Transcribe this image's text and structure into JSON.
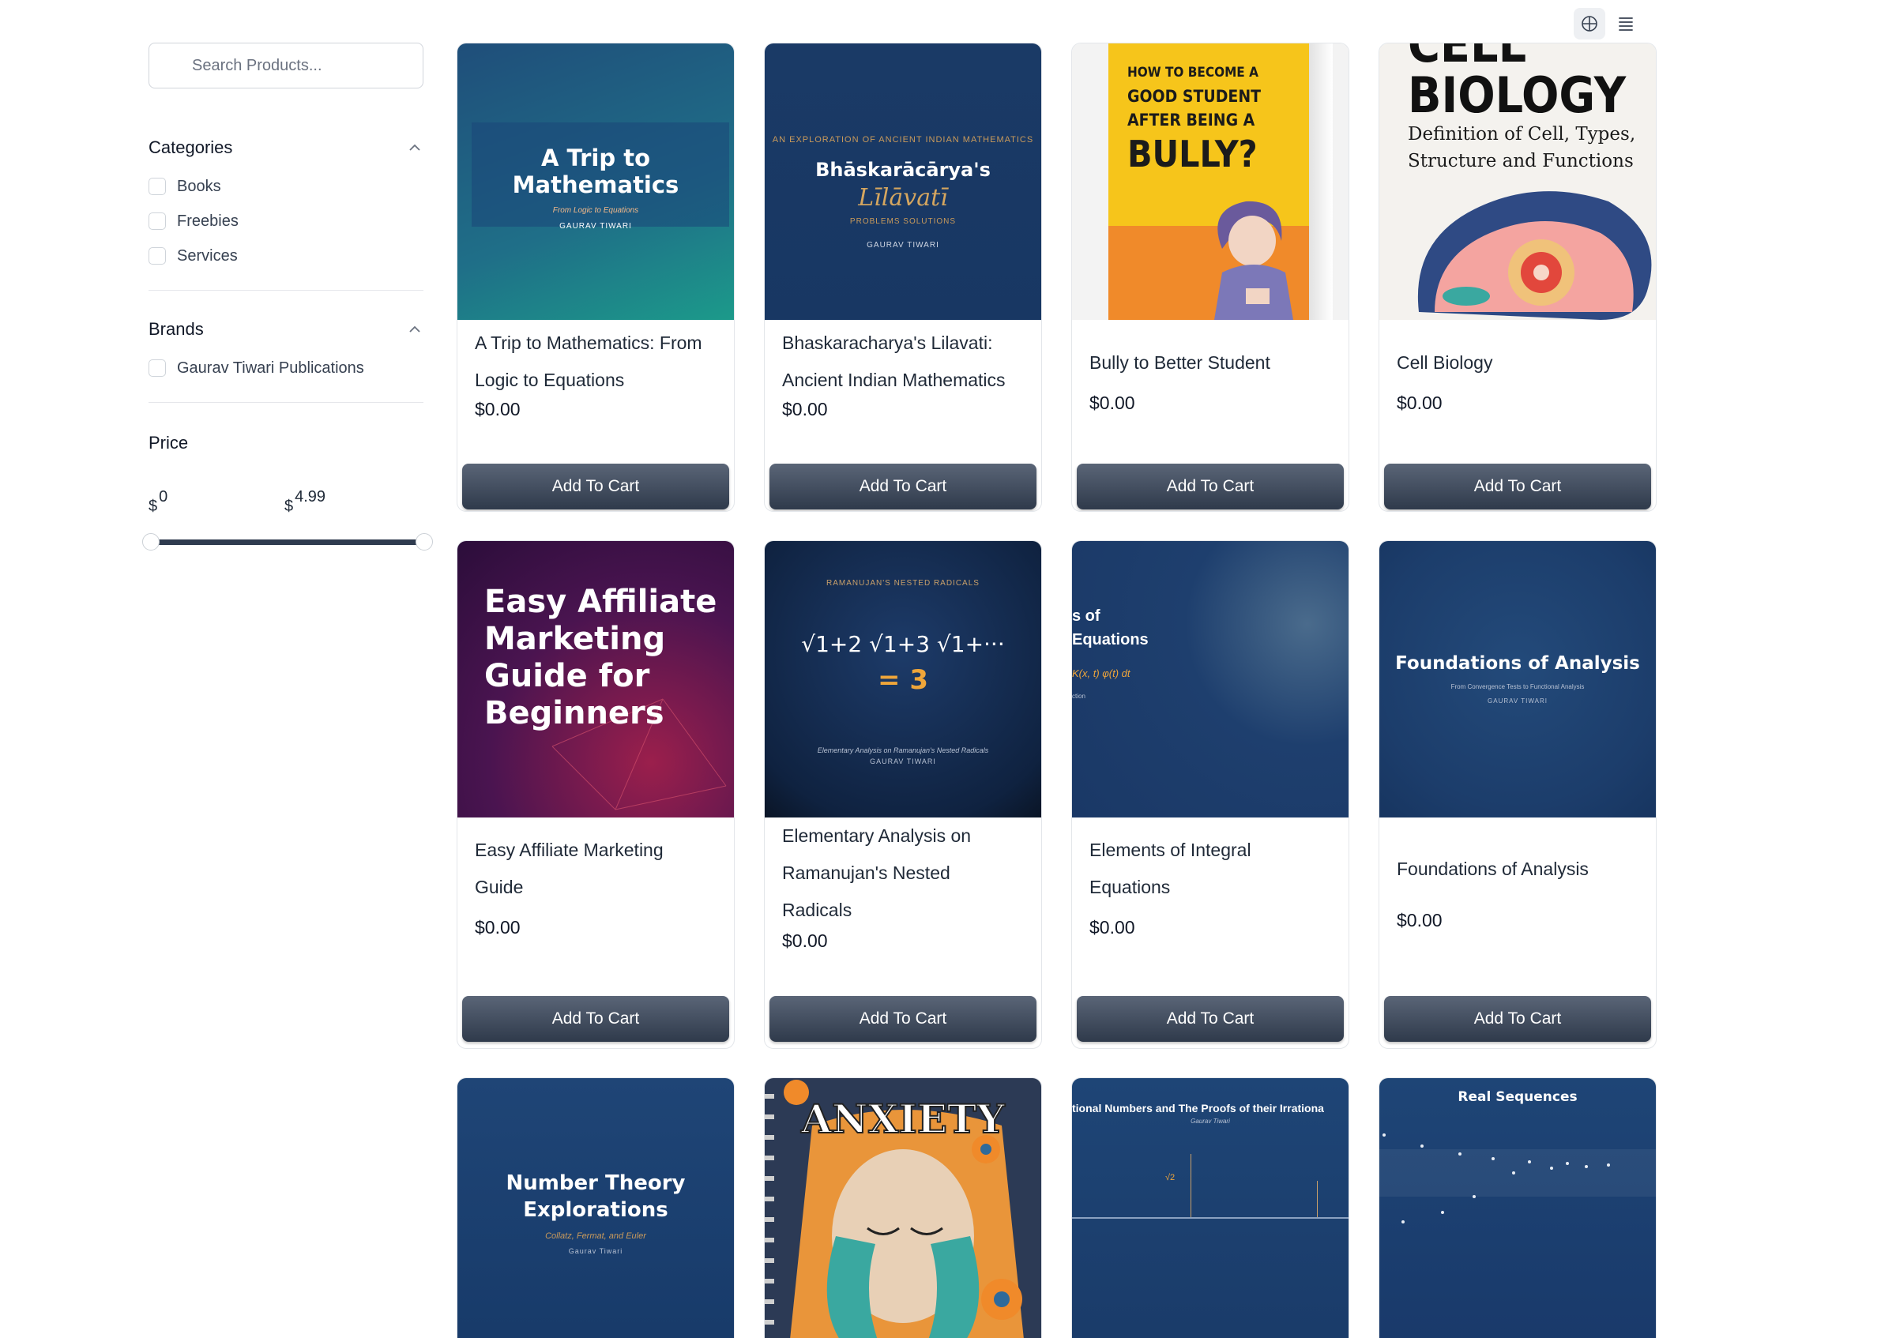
{
  "search": {
    "placeholder": "Search Products..."
  },
  "filters": {
    "categories": {
      "title": "Categories",
      "options": [
        "Books",
        "Freebies",
        "Services"
      ]
    },
    "brands": {
      "title": "Brands",
      "options": [
        "Gaurav Tiwari Publications"
      ]
    },
    "price": {
      "title": "Price",
      "currency": "$",
      "min": "0",
      "max": "4.99",
      "range_min_fraction": 0,
      "range_max_fraction": 1
    }
  },
  "products": [
    {
      "title": "A Trip to Mathematics: From Logic to Equations",
      "price": "$0.00",
      "button": "Add To Cart",
      "cover": {
        "line1": "A Trip to",
        "line2": "Mathematics",
        "sub": "From Logic to Equations",
        "author": "GAURAV TIWARI"
      }
    },
    {
      "title": "Bhaskaracharya's Lilavati: Ancient Indian Mathematics",
      "price": "$0.00",
      "button": "Add To Cart",
      "cover": {
        "top": "AN EXPLORATION OF ANCIENT INDIAN MATHEMATICS",
        "line1": "Bhāskarācārya's",
        "line2": "Līlāvatī",
        "sub": "PROBLEMS  SOLUTIONS",
        "author": "GAURAV TIWARI"
      }
    },
    {
      "title": "Bully to Better Student",
      "price": "$0.00",
      "button": "Add To Cart",
      "cover": {
        "line1": "HOW TO BECOME A",
        "line2": "GOOD STUDENT",
        "line3": "AFTER BEING A",
        "line4": "BULLY?"
      }
    },
    {
      "title": "Cell Biology",
      "price": "$0.00",
      "button": "Add To Cart",
      "cover": {
        "line0": "CELL",
        "line1": "BIOLOGY",
        "line2": "Definition of Cell, Types,",
        "line3": "Structure and Functions"
      }
    },
    {
      "title": "Easy Affiliate Marketing Guide",
      "price": "$0.00",
      "button": "Add To Cart",
      "cover": {
        "line1": "Easy Affiliate",
        "line2": "Marketing",
        "line3": "Guide for",
        "line4": "Beginners"
      }
    },
    {
      "title": "Elementary Analysis on Ramanujan's Nested Radicals",
      "price": "$0.00",
      "button": "Add To Cart",
      "cover": {
        "top": "RAMANUJAN'S NESTED RADICALS",
        "formula": "√1+2 √1+3 √1+···",
        "result": "= 3",
        "sub": "Elementary Analysis on Ramanujan's Nested Radicals",
        "author": "GAURAV TIWARI"
      }
    },
    {
      "title": "Elements of Integral Equations",
      "price": "$0.00",
      "button": "Add To Cart",
      "cover": {
        "line1": "s of",
        "line2": "Equations",
        "formula": "K(x, t) φ(t) dt",
        "small": "ction"
      }
    },
    {
      "title": "Foundations of Analysis",
      "price": "$0.00",
      "button": "Add To Cart",
      "cover": {
        "line1": "Foundations of Analysis",
        "sub": "From Convergence Tests to Functional Analysis",
        "author": "GAURAV TIWARI"
      }
    },
    {
      "title": "",
      "price": "",
      "button": "",
      "cover": {
        "line1": "Number Theory",
        "line2": "Explorations",
        "sub": "Collatz, Fermat, and Euler",
        "author": "Gaurav Tiwari"
      }
    },
    {
      "title": "",
      "price": "",
      "button": "",
      "cover": {
        "line1": "ANXIETY"
      }
    },
    {
      "title": "",
      "price": "",
      "button": "",
      "cover": {
        "line1": "tional Numbers and The Proofs of their Irrationa",
        "author": "Gaurav Tiwari",
        "mark": "√2"
      }
    },
    {
      "title": "",
      "price": "",
      "button": "",
      "cover": {
        "line1": "Real Sequences"
      }
    }
  ]
}
